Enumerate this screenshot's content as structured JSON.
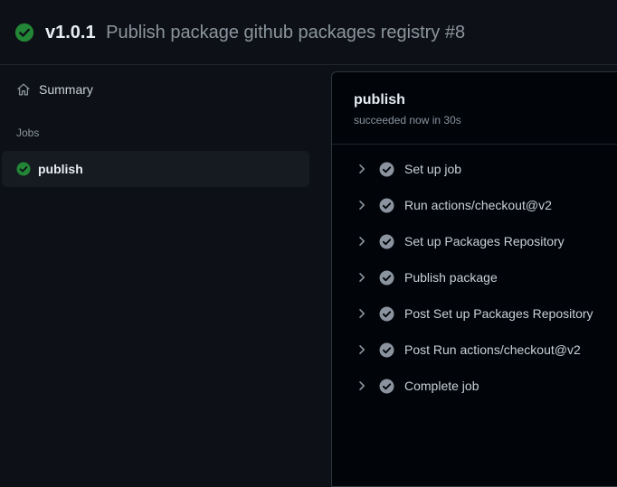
{
  "header": {
    "version": "v1.0.1",
    "workflow_name": "Publish package github packages registry #8",
    "status_icon": "check-circle-fill-icon",
    "status_color": "#238636"
  },
  "sidebar": {
    "summary_label": "Summary",
    "summary_icon": "home-icon",
    "jobs_heading": "Jobs",
    "jobs": [
      {
        "label": "publish",
        "status": "success",
        "icon": "check-circle-fill-icon"
      }
    ]
  },
  "job_panel": {
    "title": "publish",
    "subtitle": "succeeded now in 30s",
    "steps": [
      {
        "label": "Set up job"
      },
      {
        "label": "Run actions/checkout@v2"
      },
      {
        "label": "Set up Packages Repository"
      },
      {
        "label": "Publish package"
      },
      {
        "label": "Post Set up Packages Repository"
      },
      {
        "label": "Post Run actions/checkout@v2"
      },
      {
        "label": "Complete job"
      }
    ],
    "step_icon": "check-circle-fill-icon",
    "step_icon_color": "#8b949e",
    "expand_icon": "chevron-right-icon"
  }
}
